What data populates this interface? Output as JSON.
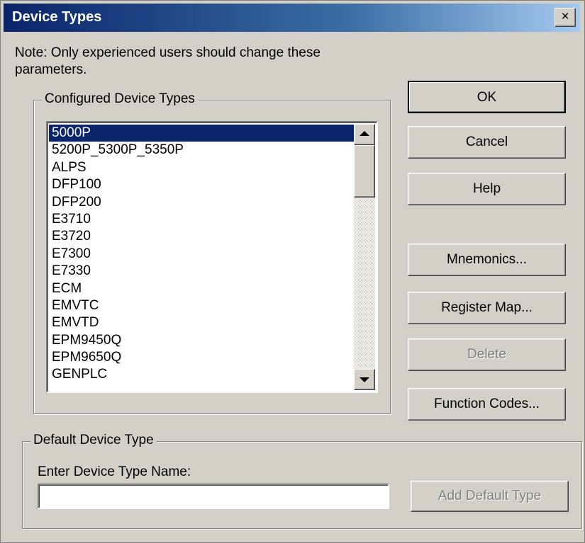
{
  "window": {
    "title": "Device Types",
    "close_glyph": "×"
  },
  "note": "Note: Only experienced users should change these parameters.",
  "configured_group": {
    "label": "Configured Device Types",
    "selected_index": 0,
    "items": [
      "5000P",
      "5200P_5300P_5350P",
      "ALPS",
      "DFP100",
      "DFP200",
      "E3710",
      "E3720",
      "E7300",
      "E7330",
      "ECM",
      "EMVTC",
      "EMVTD",
      "EPM9450Q",
      "EPM9650Q",
      "GENPLC"
    ]
  },
  "buttons": {
    "ok": "OK",
    "cancel": "Cancel",
    "help": "Help",
    "mnemonics": "Mnemonics...",
    "register_map": "Register Map...",
    "delete": "Delete",
    "function_codes": "Function Codes...",
    "add_default_type": "Add Default Type"
  },
  "default_group": {
    "label": "Default Device Type",
    "input_label": "Enter Device Type Name:",
    "input_value": ""
  },
  "icons": {
    "close": "close-icon",
    "scroll_up": "scroll-up-arrow-icon",
    "scroll_down": "scroll-down-arrow-icon"
  },
  "colors": {
    "title_start": "#0a246a",
    "title_end": "#a6caf0",
    "face": "#d4d0c8",
    "selection": "#0a246a"
  }
}
